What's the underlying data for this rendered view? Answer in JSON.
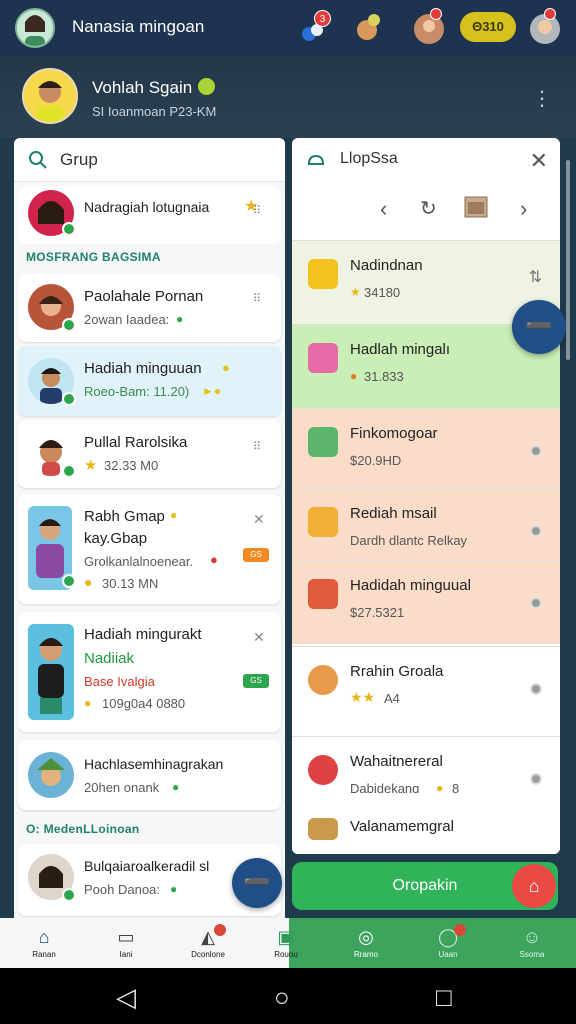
{
  "topbar": {
    "title": "Nanasia mingoan",
    "badge_1": "3",
    "coins": "Θ310"
  },
  "profile": {
    "name": "Vohlah Sgain",
    "subtitle": "SI Ioanmoan P23-KM"
  },
  "left_panel": {
    "search_label": "Grup",
    "pinned": {
      "name": "Nadragiah lotugnaia"
    },
    "section_1": "MOSFRANG BAGSIMA",
    "section_2": "O: MedenLLoinoan",
    "cards": [
      {
        "name": "Paolahale Pornan",
        "sub": "2owan Iaadea:"
      },
      {
        "name": "Hadiah minguuan",
        "sub": "Roeo-Bam: 11.20)"
      },
      {
        "name": "Pullal Rarolsika",
        "sub": "32.33 M0"
      },
      {
        "name": "Rabh Gmap",
        "name2": "kay.Gbap",
        "sub": "Grolkanlalnoenear.",
        "sub2": "30.13 MN",
        "tag": "GS"
      },
      {
        "name": "Hadiah mingurakt",
        "name2": "Nadiiak",
        "name3": "Base Ivalgia",
        "sub": "109g0a4 0880",
        "tag": "GS"
      },
      {
        "name": "Hachlasemhinagrakan",
        "sub": "20hen onank"
      },
      {
        "name": "Bulqaiaroalkeradil sl",
        "sub": "Pooh Danoa:"
      }
    ]
  },
  "right_panel": {
    "title": "LlopSsa",
    "items": [
      {
        "name": "Nadindnan",
        "sub": "34180",
        "bg": "#eef3e2",
        "icon": "#f3c21c"
      },
      {
        "name": "Hadlah mingalı",
        "sub": "31.833",
        "bg": "#c9efb7",
        "icon": "#e56aa5"
      },
      {
        "name": "Finkomogoar",
        "sub": "$20.9HD",
        "bg": "#fbdcc8",
        "icon": "#5bb56c"
      },
      {
        "name": "Rediah msail",
        "sub": "Dardh dlantc Relkay",
        "bg": "#fbdcc8",
        "icon": "#f0b036"
      },
      {
        "name": "Hadidah minguual",
        "sub": "$27.5321",
        "bg": "#fbdcc8",
        "icon": "#e05b3c"
      },
      {
        "name": "Rrahin Groala",
        "sub": "A4",
        "bg": "#ffffff",
        "icon": "#e79b4a"
      },
      {
        "name": "Wahaitnereral",
        "sub": "Dabidekanɑ",
        "sub2": "8",
        "bg": "#ffffff",
        "icon": "#df4243"
      },
      {
        "name": "Valanamemgral",
        "sub": "",
        "bg": "#ffffff",
        "icon": "#c89a4a"
      }
    ]
  },
  "action_button": "Oropakin",
  "bottom_nav": {
    "items": [
      "Ranan",
      "Iani",
      "Dconlone",
      "Rouou",
      "Rramo",
      "Uaan",
      "Ssoma"
    ]
  },
  "colors": {
    "topbar": "#1d3350",
    "accent_green": "#2fb45a",
    "fab_blue": "#1f4f86",
    "coin_yellow": "#d6c11d"
  }
}
